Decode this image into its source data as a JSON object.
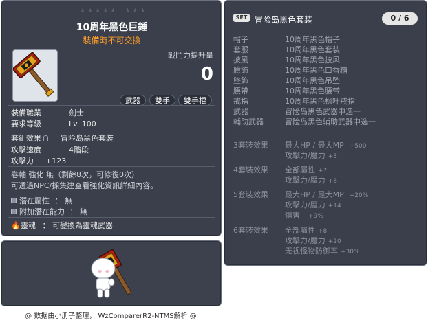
{
  "corner_id": "01422142",
  "item": {
    "name": "10周年黑色巨錘",
    "untradeable": "裝備時不可交換",
    "icon": "giant-hammer-icon",
    "combat_power_label": "戰鬥力提升量",
    "combat_power_value": "0",
    "tags": [
      "武器",
      "雙手",
      "雙手棍"
    ],
    "job_label": "裝備職業",
    "job_value": "劍士",
    "req_level_label": "要求等級",
    "req_level_value": "Lv. 100",
    "set_effect_label": "套組效果",
    "set_effect_value": "冒险岛黑色套装",
    "attack_speed_label": "攻擊速度",
    "attack_speed_value": "4階段",
    "attack_label": "攻擊力",
    "attack_value": "+123",
    "scroll_line": "卷軸 強化 無（剩餘8次，可修復0次）",
    "npc_line": "可透過NPC/採集建查看強化資訊詳細內容。",
    "potential_label": "潛在屬性",
    "potential_value": "：  無",
    "additional_potential_label": "附加潛在能力",
    "additional_potential_value": "：  無",
    "soul_label": "靈魂",
    "soul_value": "：  可變換為靈魂武器"
  },
  "set_panel": {
    "badge": "SET",
    "title": "冒险岛黑色套装",
    "count": "0 / 6",
    "parts": [
      {
        "part": "帽子",
        "name": "10周年黑色帽子"
      },
      {
        "part": "套服",
        "name": "10周年黑色套装"
      },
      {
        "part": "披風",
        "name": "10周年黑色披风"
      },
      {
        "part": "臉飾",
        "name": "10周年黑色口香糖"
      },
      {
        "part": "墜飾",
        "name": "10周年黑色吊坠"
      },
      {
        "part": "腰帶",
        "name": "10周年黑色腰带"
      },
      {
        "part": "戒指",
        "name": "10周年黑色枫叶戒指"
      },
      {
        "part": "武器",
        "name": "冒险岛黑色武器中选一"
      },
      {
        "part": "輔助武器",
        "name": "冒险岛黑色辅助武器中选一"
      }
    ],
    "bonuses": [
      {
        "title": "3套裝效果",
        "lines": [
          {
            "text": "最大HP / 最大MP",
            "num": "+500"
          },
          {
            "text": "攻擊力/魔力",
            "num": "+3"
          }
        ]
      },
      {
        "title": "4套裝效果",
        "lines": [
          {
            "text": "全部屬性",
            "num": "+7"
          },
          {
            "text": "攻擊力/魔力",
            "num": "+8"
          }
        ]
      },
      {
        "title": "5套裝效果",
        "lines": [
          {
            "text": "最大HP / 最大MP",
            "num": "+20%"
          },
          {
            "text": "攻擊力/魔力",
            "num": "+14"
          },
          {
            "text": "傷害",
            "num": "+9%"
          }
        ]
      },
      {
        "title": "6套裝效果",
        "lines": [
          {
            "text": "全部屬性",
            "num": "+8"
          },
          {
            "text": "攻擊力/魔力",
            "num": "+20"
          },
          {
            "text": "无视怪物防御率",
            "num": "+30%"
          }
        ]
      }
    ]
  },
  "footer": "@ 数据由小册子整理， WzComparerR2-NTMS解析 @",
  "colors": {
    "panel": "#3a3f4b",
    "orange": "#ff9c2a",
    "muted": "#9ea3ad"
  }
}
